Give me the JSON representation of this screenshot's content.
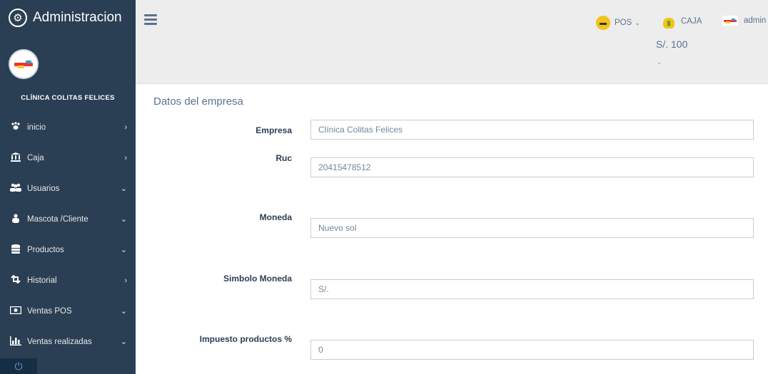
{
  "sidebar": {
    "title": "Administracion",
    "clinic_name": "CLÍNICA COLITAS FELICES",
    "items": [
      {
        "label": "inicio",
        "icon": "paw-icon",
        "chevron": "›"
      },
      {
        "label": "Caja",
        "icon": "bank-icon",
        "chevron": "›"
      },
      {
        "label": "Usuarios",
        "icon": "users-icon",
        "chevron": "⌄"
      },
      {
        "label": "Mascota /Cliente",
        "icon": "pet-client-icon",
        "chevron": "⌄"
      },
      {
        "label": "Productos",
        "icon": "database-icon",
        "chevron": "⌄"
      },
      {
        "label": "Historial",
        "icon": "retweet-icon",
        "chevron": "›"
      },
      {
        "label": "Ventas POS",
        "icon": "money-icon",
        "chevron": "⌄"
      },
      {
        "label": "Ventas realizadas",
        "icon": "bar-chart-icon",
        "chevron": "⌄"
      }
    ]
  },
  "topnav": {
    "pos_label": "POS",
    "caja_label": "CAJA",
    "caja_amount": "S/. 100",
    "user_label": "admin"
  },
  "content": {
    "title": "Datos del empresa",
    "fields": [
      {
        "label": "Empresa",
        "value": "Clínica Colitas Felices"
      },
      {
        "label": "Ruc",
        "value": "20415478512"
      },
      {
        "label": "Moneda",
        "value": "Nuevo sol"
      },
      {
        "label": "Simbolo Moneda",
        "value": "S/."
      },
      {
        "label": "Impuesto productos %",
        "value": "0"
      }
    ]
  }
}
